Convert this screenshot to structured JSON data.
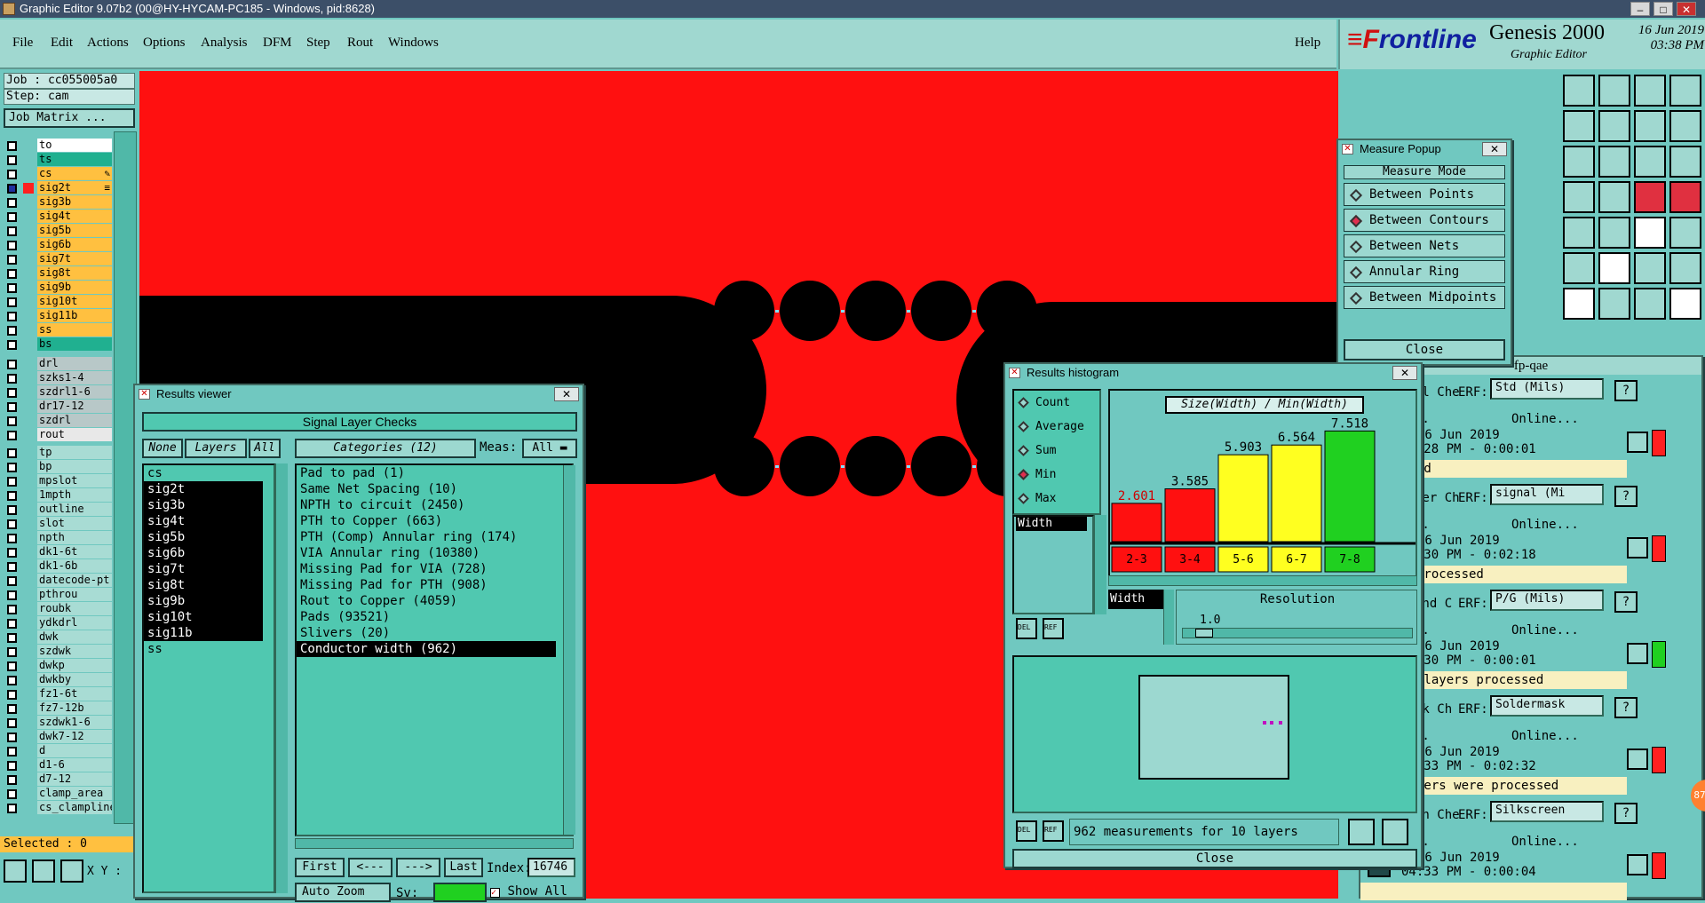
{
  "title": "Graphic Editor 9.07b2 (00@HY-HYCAM-PC185 - Windows, pid:8628)",
  "win_buttons": [
    "–",
    "□",
    "✕"
  ],
  "menu": [
    "File",
    "Edit",
    "Actions",
    "Options",
    "Analysis",
    "DFM",
    "Step",
    "Rout",
    "Windows",
    "Help"
  ],
  "brand": {
    "logo_f": "F",
    "logo_rest": "rontline",
    "product": "Genesis 2000",
    "subtitle": "Graphic Editor",
    "date": "16 Jun 2019",
    "time": "03:38 PM"
  },
  "job": {
    "job": "Job : cc055005a0",
    "step": "Step: cam",
    "matrix": "Job Matrix ...",
    "selected": "Selected : 0",
    "xy": "X Y :"
  },
  "layers_group1": [
    {
      "name": "to",
      "color": "#ffffff"
    },
    {
      "name": "ts",
      "color": "#20b090"
    },
    {
      "name": "cs",
      "color": "#ffc040",
      "suffix": "✎"
    },
    {
      "name": "sig2t",
      "color": "#ffc040",
      "sel": true,
      "mark": "#ff2020",
      "suffix": "≡"
    },
    {
      "name": "sig3b",
      "color": "#ffc040"
    },
    {
      "name": "sig4t",
      "color": "#ffc040"
    },
    {
      "name": "sig5b",
      "color": "#ffc040"
    },
    {
      "name": "sig6b",
      "color": "#ffc040"
    },
    {
      "name": "sig7t",
      "color": "#ffc040"
    },
    {
      "name": "sig8t",
      "color": "#ffc040"
    },
    {
      "name": "sig9b",
      "color": "#ffc040"
    },
    {
      "name": "sig10t",
      "color": "#ffc040"
    },
    {
      "name": "sig11b",
      "color": "#ffc040"
    },
    {
      "name": "ss",
      "color": "#ffc040"
    },
    {
      "name": "bs",
      "color": "#20b090"
    }
  ],
  "layers_group2": [
    {
      "name": "drl",
      "color": "#b8c8c8"
    },
    {
      "name": "szks1-4",
      "color": "#b8c8c8"
    },
    {
      "name": "szdrl1-6",
      "color": "#b8c8c8"
    },
    {
      "name": "dr17-12",
      "color": "#b8c8c8"
    },
    {
      "name": "szdrl",
      "color": "#b8c8c8"
    },
    {
      "name": "rout",
      "color": "#e8e8e8"
    }
  ],
  "layers_group3": [
    "tp",
    "bp",
    "mpslot",
    "1mpth",
    "outline",
    "slot",
    "npth",
    "dk1-6t",
    "dk1-6b",
    "datecode-pt",
    "pthrou",
    "roubk",
    "ydkdrl",
    "dwk",
    "szdwk",
    "dwkp",
    "dwkby",
    "fz1-6t",
    "fz7-12b",
    "szdwk1-6",
    "dwk7-12",
    "d",
    "d1-6",
    "d7-12",
    "clamp_area",
    "cs_clampline"
  ],
  "results_viewer": {
    "title": "Results viewer",
    "header": "Signal Layer Checks",
    "btn_none": "None",
    "btn_layers": "Layers",
    "btn_all": "All",
    "categories_label": "Categories (12)",
    "meas_label": "Meas:",
    "meas_value": "All",
    "layers": [
      {
        "n": "cs",
        "hl": false
      },
      {
        "n": "sig2t",
        "hl": true
      },
      {
        "n": "sig3b",
        "hl": true
      },
      {
        "n": "sig4t",
        "hl": true
      },
      {
        "n": "sig5b",
        "hl": true
      },
      {
        "n": "sig6b",
        "hl": true
      },
      {
        "n": "sig7t",
        "hl": true
      },
      {
        "n": "sig8t",
        "hl": true
      },
      {
        "n": "sig9b",
        "hl": true
      },
      {
        "n": "sig10t",
        "hl": true
      },
      {
        "n": "sig11b",
        "hl": true
      },
      {
        "n": "ss",
        "hl": false
      }
    ],
    "categories": [
      {
        "n": "Pad to pad (1)",
        "hl": false
      },
      {
        "n": "Same Net Spacing (10)",
        "hl": false
      },
      {
        "n": "NPTH to circuit (2450)",
        "hl": false
      },
      {
        "n": "PTH to Copper (663)",
        "hl": false
      },
      {
        "n": "PTH (Comp) Annular ring (174)",
        "hl": false
      },
      {
        "n": "VIA Annular ring (10380)",
        "hl": false
      },
      {
        "n": "Missing Pad for VIA (728)",
        "hl": false
      },
      {
        "n": "Missing Pad for PTH (908)",
        "hl": false
      },
      {
        "n": "Rout to Copper (4059)",
        "hl": false
      },
      {
        "n": "Pads (93521)",
        "hl": false
      },
      {
        "n": "Slivers (20)",
        "hl": false
      },
      {
        "n": "Conductor width (962)",
        "hl": true
      }
    ],
    "nav": [
      "First",
      "<---",
      "--->",
      "Last"
    ],
    "index_label": "Index:",
    "index_value": "16746",
    "auto_zoom": "Auto Zoom",
    "sv": "Sv:",
    "show_all": "Show All"
  },
  "measure_popup": {
    "title": "Measure Popup",
    "mode_label": "Measure Mode",
    "modes": [
      {
        "n": "Between Points",
        "on": false
      },
      {
        "n": "Between Contours",
        "on": true
      },
      {
        "n": "Between Nets",
        "on": false
      },
      {
        "n": "Annular Ring",
        "on": false
      },
      {
        "n": "Between Midpoints",
        "on": false
      }
    ],
    "close": "Close"
  },
  "histogram": {
    "title": "Results histogram",
    "modes": [
      {
        "n": "Count",
        "on": false
      },
      {
        "n": "Average",
        "on": false
      },
      {
        "n": "Sum",
        "on": false
      },
      {
        "n": "Min",
        "on": true
      },
      {
        "n": "Max",
        "on": false
      }
    ],
    "list_item": "Width",
    "chart_title": "Size(Width) / Min(Width)",
    "resolution_label": "Resolution",
    "resolution_value": "1.0",
    "field_label": "Width",
    "del": "DEL",
    "ref": "REF",
    "status": "962 measurements for 10 layers",
    "close": "Close"
  },
  "chart_data": {
    "type": "bar",
    "title": "Size(Width) / Min(Width)",
    "categories": [
      "2-3",
      "3-4",
      "5-6",
      "6-7",
      "7-8"
    ],
    "values": [
      2.601,
      3.585,
      5.903,
      6.564,
      7.518
    ],
    "colors": [
      "#ff1010",
      "#ff1010",
      "#ffff20",
      "#ffff20",
      "#20d020"
    ],
    "ylim": [
      0,
      8
    ]
  },
  "report": {
    "header": "fp-qae",
    "rows": [
      {
        "name": "ard-Drill Che",
        "erf": "ERF:",
        "erf_val": "Std (Mils)",
        "ranges": "Ranges...",
        "online": "Online...",
        "date": "16 Jun 2019",
        "time": "04:28 PM - 0:00:01",
        "msg": "processed",
        "status": "#ff2020"
      },
      {
        "name": "gnal Layer Ch",
        "erf": "ERF:",
        "erf_val": "signal (Mi",
        "ranges": "Ranges...",
        "online": "Online...",
        "date": "16 Jun 2019",
        "time": "04:30 PM - 0:02:18",
        "msg": "s were processed",
        "status": "#ff2020"
      },
      {
        "name": "wer/Ground C",
        "erf": "ERF:",
        "erf_val": "P/G (Mils)",
        "ranges": "Ranges...",
        "online": "Online...",
        "date": "16 Jun 2019",
        "time": "04:30 PM - 0:00:01",
        "msg": "/ground layers processed",
        "status": "#20d020"
      },
      {
        "name": "lder Mask Ch",
        "erf": "ERF:",
        "erf_val": "Soldermask",
        "ranges": "Ranges...",
        "online": "Online...",
        "date": "16 Jun 2019",
        "time": "04:33 PM - 0:02:32",
        "msg": "Mask layers were processed",
        "status": "#ff2020"
      },
      {
        "name": "lk Screen Che",
        "erf": "ERF:",
        "erf_val": "Silkscreen",
        "ranges": "Ranges...",
        "online": "Online...",
        "date": "16 Jun 2019",
        "time": "04:33 PM - 0:00:04",
        "msg": "",
        "status": "#ff2020"
      }
    ],
    "help": "?",
    "bubble": "87"
  }
}
